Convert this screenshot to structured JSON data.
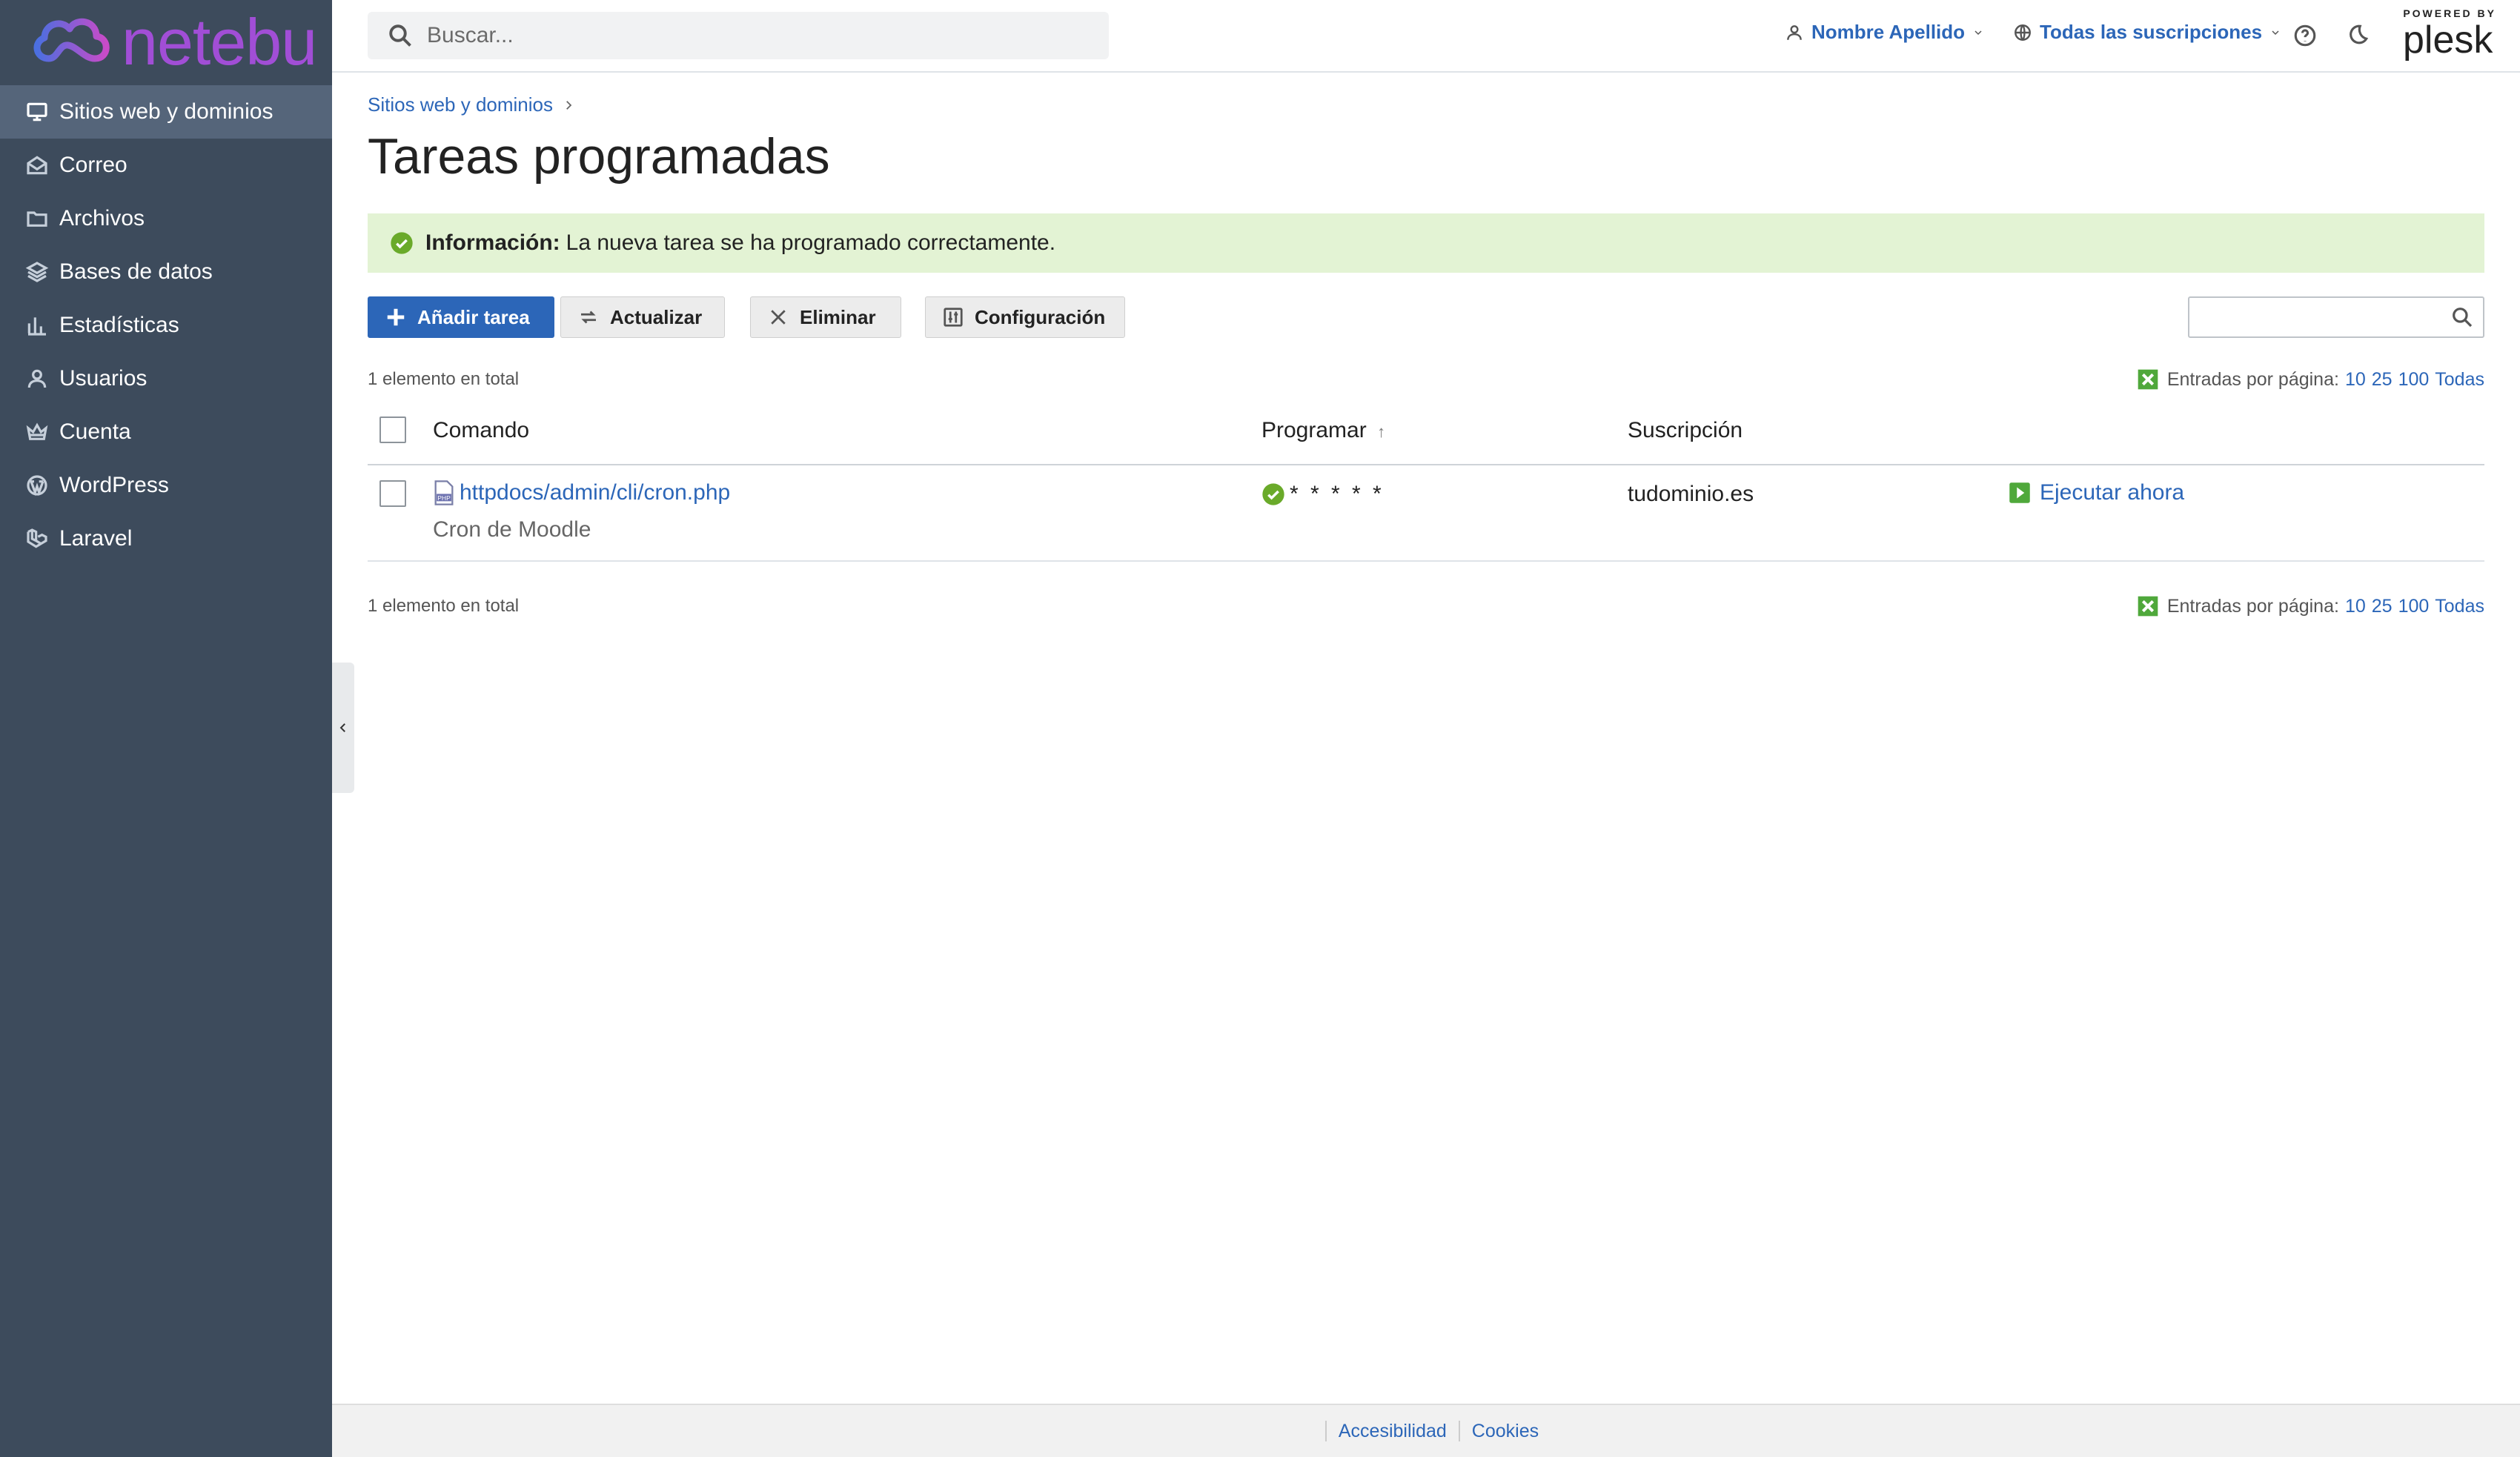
{
  "brand": {
    "name": "netebu"
  },
  "sidebar": {
    "items": [
      {
        "label": "Sitios web y dominios",
        "icon": "monitor-icon",
        "active": true
      },
      {
        "label": "Correo",
        "icon": "mail-icon",
        "active": false
      },
      {
        "label": "Archivos",
        "icon": "folder-icon",
        "active": false
      },
      {
        "label": "Bases de datos",
        "icon": "database-icon",
        "active": false
      },
      {
        "label": "Estadísticas",
        "icon": "bar-chart-icon",
        "active": false
      },
      {
        "label": "Usuarios",
        "icon": "user-icon",
        "active": false
      },
      {
        "label": "Cuenta",
        "icon": "crown-icon",
        "active": false
      },
      {
        "label": "WordPress",
        "icon": "wordpress-icon",
        "active": false
      },
      {
        "label": "Laravel",
        "icon": "laravel-icon",
        "active": false
      }
    ]
  },
  "header": {
    "search_placeholder": "Buscar...",
    "user_name": "Nombre Apellido",
    "subscriptions": "Todas las suscripciones",
    "powered_by": "POWERED BY",
    "plesk": "plesk"
  },
  "breadcrumb": {
    "item": "Sitios web y dominios"
  },
  "page_title": "Tareas programadas",
  "alert": {
    "label": "Información:",
    "message": "La nueva tarea se ha programado correctamente."
  },
  "toolbar": {
    "add": "Añadir tarea",
    "refresh": "Actualizar",
    "delete": "Eliminar",
    "settings": "Configuración"
  },
  "list": {
    "total": "1 elemento en total",
    "per_page_label": "Entradas por página:",
    "per_page_options": [
      "10",
      "25",
      "100",
      "Todas"
    ]
  },
  "table": {
    "columns": {
      "command": "Comando",
      "schedule": "Programar",
      "sort_indicator": "↑",
      "subscription": "Suscripción"
    },
    "rows": [
      {
        "command": "httpdocs/admin/cli/cron.php",
        "description": "Cron de Moodle",
        "schedule": "* * * * *",
        "subscription": "tudominio.es",
        "action": "Ejecutar ahora"
      }
    ]
  },
  "footer": {
    "accessibility": "Accesibilidad",
    "cookies": "Cookies"
  },
  "colors": {
    "sidebar_bg": "#3d4b5c",
    "sidebar_active": "#55657a",
    "link": "#2c66b8",
    "success_bg": "#e3f3d4",
    "success_icon": "#6aaa2a",
    "brand": "#a14ed6"
  }
}
